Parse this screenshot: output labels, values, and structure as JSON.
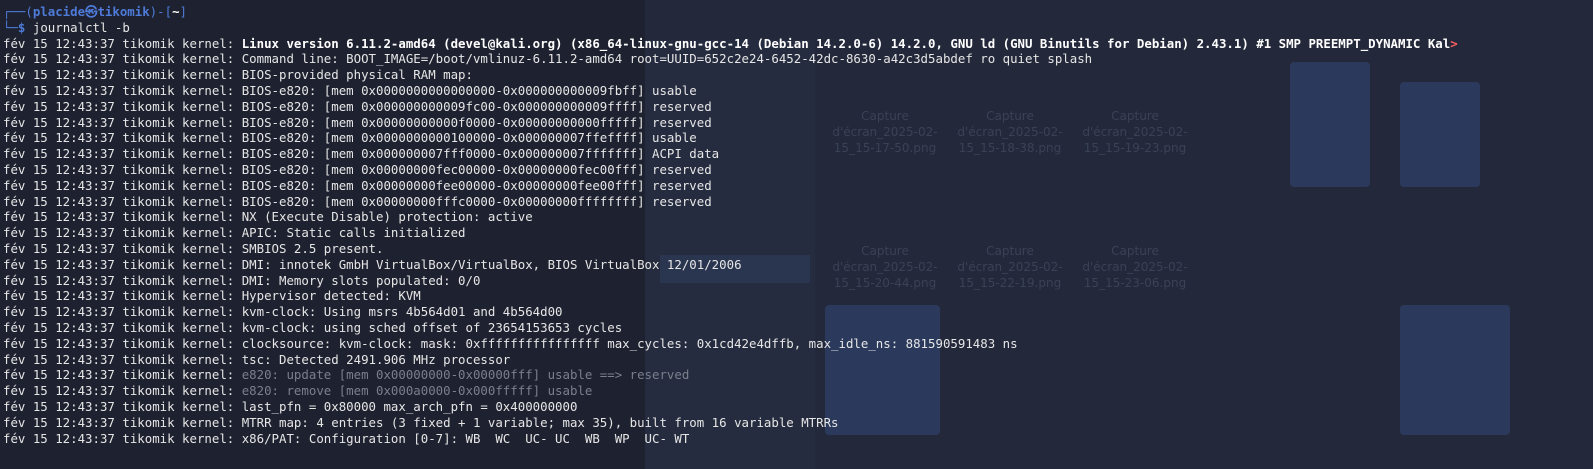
{
  "prompt": {
    "user": "placide",
    "separator_glyph": "㉿",
    "host": "tikomik",
    "path": "~",
    "dollar": "$",
    "command": "journalctl -b"
  },
  "log_prefix": "fév 15 12:43:37 tikomik kernel: ",
  "lines": [
    {
      "msg": "Linux version 6.11.2-amd64 (devel@kali.org) (x86_64-linux-gnu-gcc-14 (Debian 14.2.0-6) 14.2.0, GNU ld (GNU Binutils for Debian) 2.43.1) #1 SMP PREEMPT_DYNAMIC Kal",
      "style": "bold",
      "truncated": ">"
    },
    {
      "msg": "Command line: BOOT_IMAGE=/boot/vmlinuz-6.11.2-amd64 root=UUID=652c2e24-6452-42dc-8630-a42c3d5abdef ro quiet splash",
      "style": "normal"
    },
    {
      "msg": "BIOS-provided physical RAM map:",
      "style": "normal"
    },
    {
      "msg": "BIOS-e820: [mem 0x0000000000000000-0x000000000009fbff] usable",
      "style": "normal"
    },
    {
      "msg": "BIOS-e820: [mem 0x000000000009fc00-0x000000000009ffff] reserved",
      "style": "normal"
    },
    {
      "msg": "BIOS-e820: [mem 0x00000000000f0000-0x00000000000fffff] reserved",
      "style": "normal"
    },
    {
      "msg": "BIOS-e820: [mem 0x0000000000100000-0x000000007ffeffff] usable",
      "style": "normal"
    },
    {
      "msg": "BIOS-e820: [mem 0x000000007fff0000-0x000000007fffffff] ACPI data",
      "style": "normal"
    },
    {
      "msg": "BIOS-e820: [mem 0x00000000fec00000-0x00000000fec00fff] reserved",
      "style": "normal"
    },
    {
      "msg": "BIOS-e820: [mem 0x00000000fee00000-0x00000000fee00fff] reserved",
      "style": "normal"
    },
    {
      "msg": "BIOS-e820: [mem 0x00000000fffc0000-0x00000000ffffffff] reserved",
      "style": "normal"
    },
    {
      "msg": "NX (Execute Disable) protection: active",
      "style": "normal"
    },
    {
      "msg": "APIC: Static calls initialized",
      "style": "normal"
    },
    {
      "msg": "SMBIOS 2.5 present.",
      "style": "normal"
    },
    {
      "msg": "DMI: innotek GmbH VirtualBox/VirtualBox, BIOS VirtualBox 12/01/2006",
      "style": "normal"
    },
    {
      "msg": "DMI: Memory slots populated: 0/0",
      "style": "normal"
    },
    {
      "msg": "Hypervisor detected: KVM",
      "style": "normal"
    },
    {
      "msg": "kvm-clock: Using msrs 4b564d01 and 4b564d00",
      "style": "normal"
    },
    {
      "msg": "kvm-clock: using sched offset of 23654153653 cycles",
      "style": "normal"
    },
    {
      "msg": "clocksource: kvm-clock: mask: 0xffffffffffffffff max_cycles: 0x1cd42e4dffb, max_idle_ns: 881590591483 ns",
      "style": "normal"
    },
    {
      "msg": "tsc: Detected 2491.906 MHz processor",
      "style": "normal"
    },
    {
      "msg": "e820: update [mem 0x00000000-0x00000fff] usable ==> reserved",
      "style": "dim"
    },
    {
      "msg": "e820: remove [mem 0x000a0000-0x000fffff] usable",
      "style": "dim"
    },
    {
      "msg": "last_pfn = 0x80000 max_arch_pfn = 0x400000000",
      "style": "normal"
    },
    {
      "msg": "MTRR map: 4 entries (3 fixed + 1 variable; max 35), built from 16 variable MTRRs",
      "style": "normal"
    },
    {
      "msg": "x86/PAT: Configuration [0-7]: WB  WC  UC- UC  WB  WP  UC- WT",
      "style": "normal"
    }
  ],
  "background": {
    "thumbnail_captions": [
      "Capture d'écran_2025-02-15_15-17-50.png",
      "Capture d'écran_2025-02-15_15-18-38.png",
      "Capture d'écran_2025-02-15_15-19-23.png",
      "Capture d'écran_2025-02-15_15-20-44.png",
      "Capture d'écran_2025-02-15_15-22-19.png",
      "Capture d'écran_2025-02-15_15-23-06.png"
    ]
  },
  "colors": {
    "terminal_bg": "#1e2230",
    "prompt_accent": "#4e7bd9",
    "text": "#e6e6e6",
    "dim_text": "#7a7f8c",
    "truncation_marker": "#ff5f5f"
  }
}
